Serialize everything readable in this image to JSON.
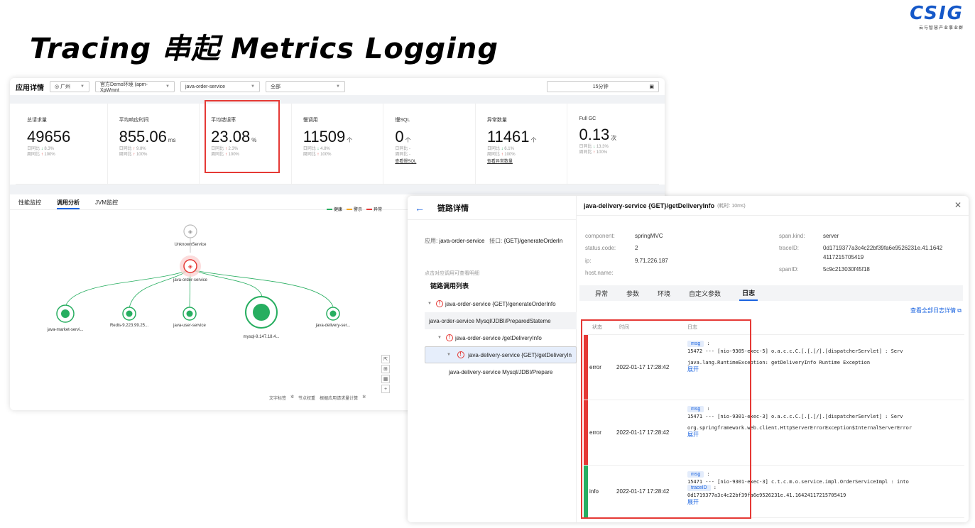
{
  "slide": {
    "title": "Tracing 串起 Metrics Logging",
    "logo_main": "CSIG",
    "logo_sub": "云与智慧产业事业群"
  },
  "app_detail": {
    "title": "应用详情",
    "region": "广州",
    "env": "官方Demo环境 (apm-XpWmnt",
    "service": "java-order-service",
    "filter": "全部",
    "time_range": "15分钟",
    "metrics": [
      {
        "label": "总请求量",
        "value": "49656",
        "unit": "",
        "day": "日同比",
        "day_val": "8.3%",
        "day_dir": "down",
        "week": "周同比",
        "week_val": "100%",
        "week_dir": "up",
        "link": ""
      },
      {
        "label": "平均响应时间",
        "value": "855.06",
        "unit": "ms",
        "day": "日同比",
        "day_val": "9.8%",
        "day_dir": "up",
        "week": "周同比",
        "week_val": "100%",
        "week_dir": "up",
        "link": ""
      },
      {
        "label": "平均错误率",
        "value": "23.08",
        "unit": "%",
        "day": "日同比",
        "day_val": "2.3%",
        "day_dir": "up",
        "week": "周同比",
        "week_val": "100%",
        "week_dir": "up",
        "link": ""
      },
      {
        "label": "慢调用",
        "value": "11509",
        "unit": "个",
        "day": "日同比",
        "day_val": "4.8%",
        "day_dir": "down",
        "week": "周同比",
        "week_val": "100%",
        "week_dir": "up",
        "link": ""
      },
      {
        "label": "慢SQL",
        "value": "0",
        "unit": "个",
        "day": "日同比",
        "day_val": "-",
        "day_dir": "",
        "week": "周同比",
        "week_val": "-",
        "week_dir": "",
        "link": "查看慢SQL"
      },
      {
        "label": "异常数量",
        "value": "11461",
        "unit": "个",
        "day": "日同比",
        "day_val": "6.1%",
        "day_dir": "down",
        "week": "周同比",
        "week_val": "100%",
        "week_dir": "up",
        "link": "查看异常数量"
      },
      {
        "label": "Full GC",
        "value": "0.13",
        "unit": "次",
        "day": "日同比",
        "day_val": "13.3%",
        "day_dir": "down",
        "week": "周同比",
        "week_val": "100%",
        "week_dir": "up",
        "link": ""
      }
    ],
    "tabs": [
      "性能监控",
      "调用分析",
      "JVM监控"
    ],
    "active_tab": 1,
    "legend": [
      "健康",
      "警示",
      "异常"
    ],
    "legend_colors": [
      "#27ae60",
      "#f5a623",
      "#e53935"
    ],
    "nodes": {
      "unknown": "UnknownService",
      "order": "java-order-service",
      "market": "java-market-servi...",
      "redis": "Redis-9.223.99.25...",
      "user": "java-user-service",
      "mysql": "mysql-9.147.18.4...",
      "delivery": "java-delivery-ser..."
    },
    "bottom_tools": [
      "文字标签",
      "节点权重",
      "根据应用请求量计算"
    ]
  },
  "trace_detail": {
    "title": "链路详情",
    "app_label": "应用:",
    "app_value": "java-order-service",
    "api_label": "接口:",
    "api_value": "{GET}/generateOrderIn",
    "hint": "点击对应调用可查看明细",
    "list_title": "链路调用列表",
    "items": [
      "java-order-service {GET}/generateOrderInfo",
      "java-order-service Mysql/JDBI/PreparedStateme",
      "java-order-service /getDeliveryInfo",
      "java-delivery-service {GET}/getDeliveryIn",
      "java-delivery-service Mysql/JDBI/Prepare"
    ]
  },
  "span_detail": {
    "title": "java-delivery-service {GET}/getDeliveryInfo",
    "elapsed": "(耗时: 10ms)",
    "component_k": "component:",
    "component_v": "springMVC",
    "status_k": "status.code:",
    "status_v": "2",
    "ip_k": "ip:",
    "ip_v": "9.71.226.187",
    "host_k": "host.name:",
    "kind_k": "span.kind:",
    "kind_v": "server",
    "trace_k": "traceID:",
    "trace_v1": "0d1719377a3c4c22bf39fa6e9526231e.41.1642",
    "trace_v2": "4117215705419",
    "span_k": "spanID:",
    "span_v": "5c9c213030f45f18",
    "tabs": [
      "异常",
      "参数",
      "环境",
      "自定义参数",
      "日志"
    ],
    "all_logs_link": "查看全部日志详情",
    "cols": [
      "状态",
      "时间",
      "日志"
    ],
    "logs": [
      {
        "status": "error",
        "time": "2022-01-17 17:28:42",
        "tag": "msg",
        "l1": "15472 --- [nio-9305-exec-5] o.a.c.c.C.[.[.[/].[dispatcherServlet]    : Serv",
        "l2": "java.lang.RuntimeException: getDeliveryInfo Runtime Exception",
        "expand": "展开",
        "color": "#e53935"
      },
      {
        "status": "error",
        "time": "2022-01-17 17:28:42",
        "tag": "msg",
        "l1": "15471 --- [nio-9301-exec-3] o.a.c.c.C.[.[.[/].[dispatcherServlet]    : Serv",
        "l2": "org.springframework.web.client.HttpServerErrorException$InternalServerError",
        "expand": "展开",
        "color": "#e53935"
      },
      {
        "status": "info",
        "time": "2022-01-17 17:28:42",
        "tag": "msg",
        "l1": "15471 --- [nio-9301-exec-3] c.t.c.m.o.service.impl.OrderServiceImpl   : into",
        "tag2": "traceID",
        "l2": "0d1719377a3c4c22bf39fa6e9526231e.41.16424117215705419",
        "expand": "展开",
        "color": "#27ae60"
      }
    ]
  }
}
